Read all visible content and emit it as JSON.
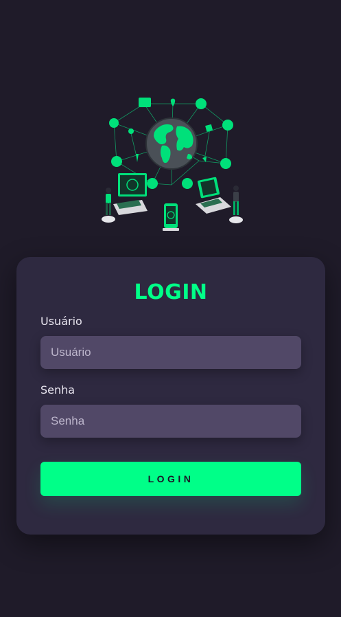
{
  "login_form": {
    "title": "LOGIN",
    "username_label": "Usuário",
    "username_placeholder": "Usuário",
    "password_label": "Senha",
    "password_placeholder": "Senha",
    "submit_label": "LOGIN"
  },
  "colors": {
    "background": "#1f1b29",
    "card": "#2e2940",
    "input": "#514867",
    "accent": "#00ff88"
  },
  "illustration": {
    "icon": "network-globe-illustration-icon"
  }
}
